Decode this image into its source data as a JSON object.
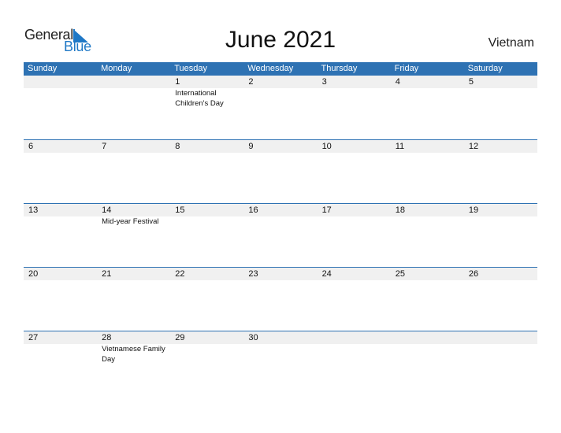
{
  "logo": {
    "part1": "General",
    "part2": "Blue",
    "icon": "triangle-flag-icon",
    "accent_color": "#1f78c6"
  },
  "title": "June 2021",
  "country": "Vietnam",
  "colors": {
    "header_bg": "#2e72b3",
    "band_bg": "#f0f0f0"
  },
  "weekdays": [
    "Sunday",
    "Monday",
    "Tuesday",
    "Wednesday",
    "Thursday",
    "Friday",
    "Saturday"
  ],
  "weeks": [
    [
      {
        "day": ""
      },
      {
        "day": ""
      },
      {
        "day": "1",
        "event": "International Children's Day"
      },
      {
        "day": "2"
      },
      {
        "day": "3"
      },
      {
        "day": "4"
      },
      {
        "day": "5"
      }
    ],
    [
      {
        "day": "6"
      },
      {
        "day": "7"
      },
      {
        "day": "8"
      },
      {
        "day": "9"
      },
      {
        "day": "10"
      },
      {
        "day": "11"
      },
      {
        "day": "12"
      }
    ],
    [
      {
        "day": "13"
      },
      {
        "day": "14",
        "event": "Mid-year Festival"
      },
      {
        "day": "15"
      },
      {
        "day": "16"
      },
      {
        "day": "17"
      },
      {
        "day": "18"
      },
      {
        "day": "19"
      }
    ],
    [
      {
        "day": "20"
      },
      {
        "day": "21"
      },
      {
        "day": "22"
      },
      {
        "day": "23"
      },
      {
        "day": "24"
      },
      {
        "day": "25"
      },
      {
        "day": "26"
      }
    ],
    [
      {
        "day": "27"
      },
      {
        "day": "28",
        "event": "Vietnamese Family Day"
      },
      {
        "day": "29"
      },
      {
        "day": "30"
      },
      {
        "day": ""
      },
      {
        "day": ""
      },
      {
        "day": ""
      }
    ]
  ]
}
